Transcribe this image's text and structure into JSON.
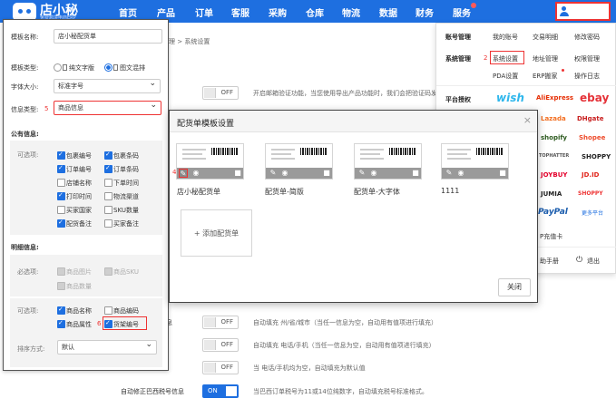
{
  "nav": {
    "logo_text": "店小秘",
    "logo_sub": "免费跨境电商ERP",
    "items": [
      "首页",
      "产品",
      "订单",
      "客服",
      "采购",
      "仓库",
      "物流",
      "数据",
      "财务",
      "服务"
    ]
  },
  "account_menu": {
    "row1_heading": "账号管理",
    "row1": [
      "我的账号",
      "交易明细",
      "修改密码"
    ],
    "row2_heading": "系统管理",
    "row2_num": "2",
    "row2": [
      "系统设置",
      "地址管理",
      "权限管理"
    ],
    "row3": [
      "PDA设置",
      "ERP搬家",
      "操作日志"
    ],
    "platform_heading": "平台授权",
    "brands": [
      "wish",
      "AliExpress",
      "ebay",
      "Lazada",
      "DHgate",
      "shopify",
      "Shopee",
      "TOPHATTER",
      "JOYBUY",
      "JD.ID",
      "MALL",
      "JUMIA",
      "SHOPPY",
      "PayPal",
      "更多平台"
    ],
    "partial_text": "P充值卡",
    "help": "助手册",
    "logout": "退出"
  },
  "background": {
    "breadcrumb": "理 > 系统设置",
    "row_intro": "开启邮箱验证功能，当您使用导出产品功能时，我们会把验证码发",
    "row_intro_toggle": "OFF",
    "rows": [
      {
        "label": "息",
        "toggle": "OFF",
        "desc": "自动填充 州/省/城市（当任一信息为空，自动用有值项进行填充）"
      },
      {
        "label": "",
        "toggle": "OFF",
        "desc": "自动填充 电话/手机（当任一信息为空，自动用有值项进行填充）"
      },
      {
        "label": "",
        "toggle": "OFF",
        "desc": "当 电话/手机均为空，自动填充为默认值"
      },
      {
        "label": "自动修正巴西税号信息",
        "toggle": "ON",
        "desc": "当巴西订单税号为11或14位纯数字，自动填充税号标准格式。"
      }
    ]
  },
  "left_panel": {
    "template_name_label": "模板名称:",
    "template_name_value": "店小秘配货单",
    "template_type_label": "模板类型:",
    "type_options": [
      "纯文字版",
      "图文混排"
    ],
    "font_size_label": "字体大小:",
    "font_size_value": "标准字号",
    "info_type_label": "信息类型:",
    "info_type_num": "5",
    "info_type_value": "商品信息",
    "public_info_title": "公有信息:",
    "optional_label": "可选项:",
    "public_checkboxes": [
      {
        "label": "包裹编号",
        "checked": true
      },
      {
        "label": "包裹条码",
        "checked": true
      },
      {
        "label": "订单编号",
        "checked": true
      },
      {
        "label": "订单条码",
        "checked": true
      },
      {
        "label": "店铺名称",
        "checked": false
      },
      {
        "label": "下单时间",
        "checked": false
      },
      {
        "label": "打印时间",
        "checked": true
      },
      {
        "label": "物流渠道",
        "checked": false
      },
      {
        "label": "买家国家",
        "checked": false
      },
      {
        "label": "SKU数量",
        "checked": false
      },
      {
        "label": "配货备注",
        "checked": true
      },
      {
        "label": "买家备注",
        "checked": false
      }
    ],
    "detail_title": "明细信息:",
    "required_label": "必选项:",
    "required_items": [
      "商品图片",
      "商品SKU",
      "商品数量"
    ],
    "optional_label_2": "可选项:",
    "detail_checkboxes": [
      {
        "label": "商品名称",
        "checked": true
      },
      {
        "label": "商品编码",
        "checked": false
      },
      {
        "label": "商品属性",
        "checked": true
      },
      {
        "label": "货架编号",
        "checked": true
      }
    ],
    "detail_num": "6",
    "sort_label": "排序方式:",
    "sort_value": "默认"
  },
  "modal": {
    "title": "配货单模板设置",
    "close_x": "×",
    "marker_num": "4",
    "templates": [
      "店小秘配货单",
      "配货单-简版",
      "配货单-大字体",
      "1111"
    ],
    "add_label": "+ 添加配货单",
    "close_button": "关闭"
  }
}
